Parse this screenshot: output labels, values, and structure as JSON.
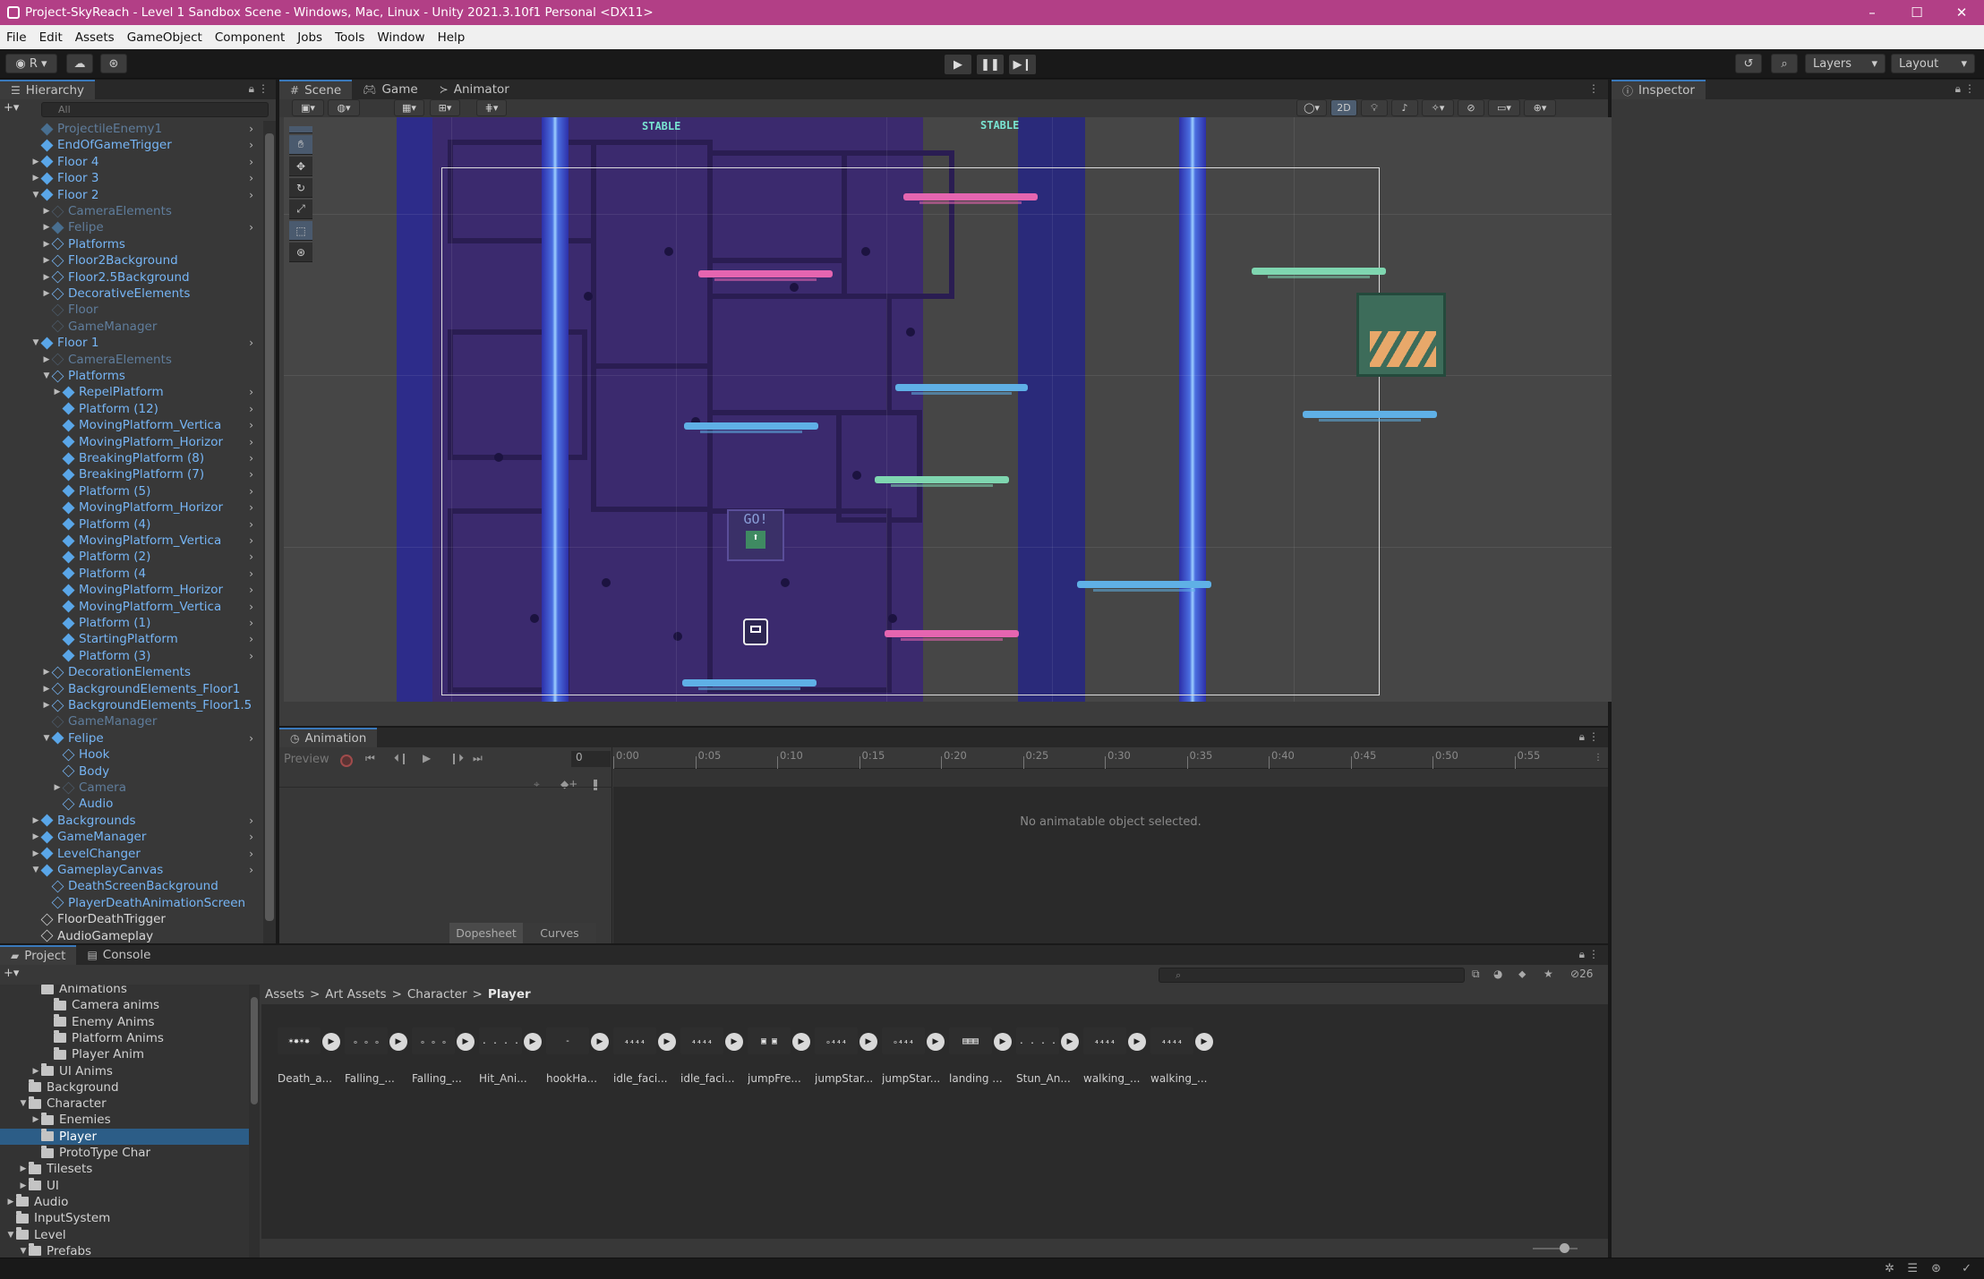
{
  "window": {
    "title": "Project-SkyReach - Level 1 Sandbox Scene - Windows, Mac, Linux - Unity 2021.3.10f1 Personal <DX11>",
    "controls": [
      "–",
      "☐",
      "✕"
    ]
  },
  "menu": [
    "File",
    "Edit",
    "Assets",
    "GameObject",
    "Component",
    "Jobs",
    "Tools",
    "Window",
    "Help"
  ],
  "toolbar": {
    "account": "R",
    "layers": "Layers",
    "layout": "Layout"
  },
  "hierarchy": {
    "tab": "Hierarchy",
    "search_placeholder": "All",
    "rows": [
      {
        "label": "ProjectileEnemy1",
        "indent": 1,
        "style": "prefab dim",
        "arrow": "",
        "chev": true
      },
      {
        "label": "EndOfGameTrigger",
        "indent": 1,
        "style": "prefab",
        "arrow": "",
        "chev": true
      },
      {
        "label": "Floor 4",
        "indent": 1,
        "style": "prefab",
        "arrow": "▶",
        "chev": true
      },
      {
        "label": "Floor 3",
        "indent": 1,
        "style": "prefab",
        "arrow": "▶",
        "chev": true
      },
      {
        "label": "Floor 2",
        "indent": 1,
        "style": "prefab",
        "arrow": "▼",
        "chev": true
      },
      {
        "label": "CameraElements",
        "indent": 2,
        "style": "dim",
        "arrow": "▶",
        "chev": false
      },
      {
        "label": "Felipe",
        "indent": 2,
        "style": "prefab dim",
        "arrow": "▶",
        "chev": true
      },
      {
        "label": "Platforms",
        "indent": 2,
        "style": "",
        "arrow": "▶",
        "chev": false
      },
      {
        "label": "Floor2Background",
        "indent": 2,
        "style": "",
        "arrow": "▶",
        "chev": false
      },
      {
        "label": "Floor2.5Background",
        "indent": 2,
        "style": "",
        "arrow": "▶",
        "chev": false
      },
      {
        "label": "DecorativeElements",
        "indent": 2,
        "style": "",
        "arrow": "▶",
        "chev": false
      },
      {
        "label": "Floor",
        "indent": 2,
        "style": "dim",
        "arrow": "",
        "chev": false
      },
      {
        "label": "GameManager",
        "indent": 2,
        "style": "dim",
        "arrow": "",
        "chev": false
      },
      {
        "label": "Floor 1",
        "indent": 1,
        "style": "prefab",
        "arrow": "▼",
        "chev": true
      },
      {
        "label": "CameraElements",
        "indent": 2,
        "style": "dim",
        "arrow": "▶",
        "chev": false
      },
      {
        "label": "Platforms",
        "indent": 2,
        "style": "",
        "arrow": "▼",
        "chev": false
      },
      {
        "label": "RepelPlatform",
        "indent": 3,
        "style": "prefab",
        "arrow": "▶",
        "chev": true
      },
      {
        "label": "Platform (12)",
        "indent": 3,
        "style": "prefab",
        "arrow": "",
        "chev": true
      },
      {
        "label": "MovingPlatform_Vertica",
        "indent": 3,
        "style": "prefab",
        "arrow": "",
        "chev": true
      },
      {
        "label": "MovingPlatform_Horizor",
        "indent": 3,
        "style": "prefab",
        "arrow": "",
        "chev": true
      },
      {
        "label": "BreakingPlatform (8)",
        "indent": 3,
        "style": "prefab",
        "arrow": "",
        "chev": true
      },
      {
        "label": "BreakingPlatform (7)",
        "indent": 3,
        "style": "prefab",
        "arrow": "",
        "chev": true
      },
      {
        "label": "Platform (5)",
        "indent": 3,
        "style": "prefab",
        "arrow": "",
        "chev": true
      },
      {
        "label": "MovingPlatform_Horizor",
        "indent": 3,
        "style": "prefab",
        "arrow": "",
        "chev": true
      },
      {
        "label": "Platform (4)",
        "indent": 3,
        "style": "prefab",
        "arrow": "",
        "chev": true
      },
      {
        "label": "MovingPlatform_Vertica",
        "indent": 3,
        "style": "prefab",
        "arrow": "",
        "chev": true
      },
      {
        "label": "Platform (2)",
        "indent": 3,
        "style": "prefab",
        "arrow": "",
        "chev": true
      },
      {
        "label": "Platform (4",
        "indent": 3,
        "style": "prefab",
        "arrow": "",
        "chev": true
      },
      {
        "label": "MovingPlatform_Horizor",
        "indent": 3,
        "style": "prefab",
        "arrow": "",
        "chev": true
      },
      {
        "label": "MovingPlatform_Vertica",
        "indent": 3,
        "style": "prefab",
        "arrow": "",
        "chev": true
      },
      {
        "label": "Platform (1)",
        "indent": 3,
        "style": "prefab",
        "arrow": "",
        "chev": true
      },
      {
        "label": "StartingPlatform",
        "indent": 3,
        "style": "prefab",
        "arrow": "",
        "chev": true
      },
      {
        "label": "Platform (3)",
        "indent": 3,
        "style": "prefab",
        "arrow": "",
        "chev": true
      },
      {
        "label": "DecorationElements",
        "indent": 2,
        "style": "",
        "arrow": "▶",
        "chev": false
      },
      {
        "label": "BackgroundElements_Floor1",
        "indent": 2,
        "style": "",
        "arrow": "▶",
        "chev": false
      },
      {
        "label": "BackgroundElements_Floor1.5",
        "indent": 2,
        "style": "",
        "arrow": "▶",
        "chev": false
      },
      {
        "label": "GameManager",
        "indent": 2,
        "style": "dim",
        "arrow": "",
        "chev": false
      },
      {
        "label": "Felipe",
        "indent": 2,
        "style": "prefab",
        "arrow": "▼",
        "chev": true
      },
      {
        "label": "Hook",
        "indent": 3,
        "style": "",
        "arrow": "",
        "chev": false
      },
      {
        "label": "Body",
        "indent": 3,
        "style": "",
        "arrow": "",
        "chev": false
      },
      {
        "label": "Camera",
        "indent": 3,
        "style": "dim",
        "arrow": "▶",
        "chev": false
      },
      {
        "label": "Audio",
        "indent": 3,
        "style": "",
        "arrow": "",
        "chev": false
      },
      {
        "label": "Backgrounds",
        "indent": 1,
        "style": "prefab",
        "arrow": "▶",
        "chev": true
      },
      {
        "label": "GameManager",
        "indent": 1,
        "style": "prefab",
        "arrow": "▶",
        "chev": true
      },
      {
        "label": "LevelChanger",
        "indent": 1,
        "style": "prefab",
        "arrow": "▶",
        "chev": true
      },
      {
        "label": "GameplayCanvas",
        "indent": 1,
        "style": "prefab",
        "arrow": "▼",
        "chev": true
      },
      {
        "label": "DeathScreenBackground",
        "indent": 2,
        "style": "",
        "arrow": "",
        "chev": false
      },
      {
        "label": "PlayerDeathAnimationScreen",
        "indent": 2,
        "style": "",
        "arrow": "",
        "chev": false
      },
      {
        "label": "FloorDeathTrigger",
        "indent": 1,
        "style": "plain",
        "arrow": "",
        "chev": false
      },
      {
        "label": "AudioGameplay",
        "indent": 1,
        "style": "plain",
        "arrow": "",
        "chev": false
      }
    ]
  },
  "scene": {
    "tabs": [
      "Scene",
      "Game",
      "Animator"
    ],
    "toggle_2d": "2D",
    "stable_signs": [
      "STABLE",
      "STABLE"
    ],
    "go_sign": "GO!"
  },
  "inspector": {
    "tab": "Inspector"
  },
  "animation": {
    "tab": "Animation",
    "preview": "Preview",
    "frame": "0",
    "times": [
      "0:00",
      "0:05",
      "0:10",
      "0:15",
      "0:20",
      "0:25",
      "0:30",
      "0:35",
      "0:40",
      "0:45",
      "0:50",
      "0:55"
    ],
    "empty_message": "No animatable object selected.",
    "views": [
      "Dopesheet",
      "Curves"
    ]
  },
  "project": {
    "tabs": [
      "Project",
      "Console"
    ],
    "hidden_count": "26",
    "breadcrumb": [
      "Assets",
      "Art Assets",
      "Character",
      "Player"
    ],
    "tree": [
      {
        "label": "Animations",
        "indent": 3,
        "arrow": "",
        "sel": false
      },
      {
        "label": "Camera anims",
        "indent": 4,
        "arrow": "",
        "sel": false
      },
      {
        "label": "Enemy Anims",
        "indent": 4,
        "arrow": "",
        "sel": false
      },
      {
        "label": "Platform Anims",
        "indent": 4,
        "arrow": "",
        "sel": false
      },
      {
        "label": "Player Anim",
        "indent": 4,
        "arrow": "",
        "sel": false
      },
      {
        "label": "UI Anims",
        "indent": 3,
        "arrow": "▶",
        "sel": false
      },
      {
        "label": "Background",
        "indent": 2,
        "arrow": "",
        "sel": false
      },
      {
        "label": "Character",
        "indent": 2,
        "arrow": "▼",
        "sel": false
      },
      {
        "label": "Enemies",
        "indent": 3,
        "arrow": "▶",
        "sel": false
      },
      {
        "label": "Player",
        "indent": 3,
        "arrow": "",
        "sel": true
      },
      {
        "label": "ProtoType Char",
        "indent": 3,
        "arrow": "",
        "sel": false
      },
      {
        "label": "Tilesets",
        "indent": 2,
        "arrow": "▶",
        "sel": false
      },
      {
        "label": "UI",
        "indent": 2,
        "arrow": "▶",
        "sel": false
      },
      {
        "label": "Audio",
        "indent": 1,
        "arrow": "▶",
        "sel": false
      },
      {
        "label": "InputSystem",
        "indent": 1,
        "arrow": "",
        "sel": false
      },
      {
        "label": "Level",
        "indent": 1,
        "arrow": "▼",
        "sel": false
      },
      {
        "label": "Prefabs",
        "indent": 2,
        "arrow": "▼",
        "sel": false
      }
    ],
    "assets": [
      {
        "name": "Death_a...",
        "thumb": "✶✸✶✸"
      },
      {
        "name": "Falling_...",
        "thumb": "ₒ ₒ ₒ"
      },
      {
        "name": "Falling_...",
        "thumb": "ₒ ₒ ₒ"
      },
      {
        "name": "Hit_Ani...",
        "thumb": ". . . ."
      },
      {
        "name": "hookHa...",
        "thumb": "-"
      },
      {
        "name": "idle_faci...",
        "thumb": "₄₄₄₄"
      },
      {
        "name": "idle_faci...",
        "thumb": "₄₄₄₄"
      },
      {
        "name": "jumpFre...",
        "thumb": "▣ ▣"
      },
      {
        "name": "jumpStar...",
        "thumb": "ₒ₄₄₄"
      },
      {
        "name": "jumpStar...",
        "thumb": "ₒ₄₄₄"
      },
      {
        "name": "landing ...",
        "thumb": "▤▤▤"
      },
      {
        "name": "Stun_An...",
        "thumb": ". . . ."
      },
      {
        "name": "walking_...",
        "thumb": "₄₄₄₄"
      },
      {
        "name": "walking_...",
        "thumb": "₄₄₄₄"
      }
    ]
  }
}
